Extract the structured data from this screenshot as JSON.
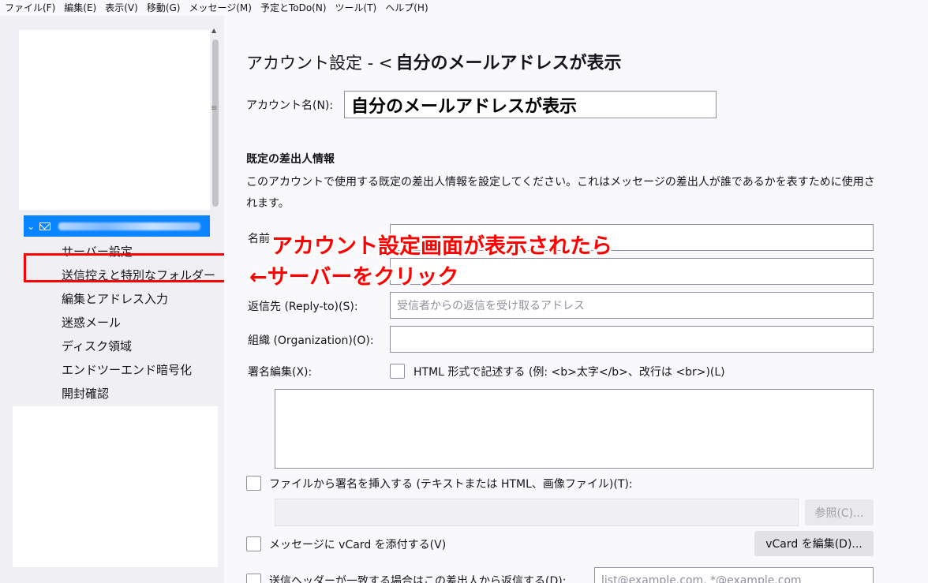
{
  "menubar": {
    "items": [
      "ファイル(F)",
      "編集(E)",
      "表示(V)",
      "移動(G)",
      "メッセージ(M)",
      "予定とToDo(N)",
      "ツール(T)",
      "ヘルプ(H)"
    ]
  },
  "sidebar": {
    "nav_items": [
      "サーバー設定",
      "送信控えと特別なフォルダー",
      "編集とアドレス入力",
      "迷惑メール",
      "ディスク領域",
      "エンドツーエンド暗号化",
      "開封確認"
    ]
  },
  "main": {
    "title_prefix": "アカウント設定 - <",
    "title_account": "自分のメールアドレスが表示",
    "account_name_label": "アカウント名(N):",
    "account_name_value": "自分のメールアドレスが表示",
    "section_heading": "既定の差出人情報",
    "description": "このアカウントで使用する既定の差出人情報を設定してください。これはメッセージの差出人が誰であるかを表すために使用されます。",
    "name_label": "名前",
    "reply_to_label": "返信先 (Reply-to)(S):",
    "reply_to_placeholder": "受信者からの返信を受け取るアドレス",
    "organization_label": "組織 (Organization)(O):",
    "signature_label": "署名編集(X):",
    "html_checkbox_label": "HTML 形式で記述する (例: <b>太字</b>、改行は <br>)(L)",
    "file_signature_label": "ファイルから署名を挿入する (テキストまたは HTML、画像ファイル)(T):",
    "browse_button": "参照(C)...",
    "vcard_label": "メッセージに vCard を添付する(V)",
    "vcard_edit_button": "vCard を編集(D)...",
    "reply_header_label": "送信ヘッダーが一致する場合はこの差出人から返信する(D):",
    "reply_header_placeholder": "list@example.com, *@example.com"
  },
  "annotations": {
    "line1": "アカウント設定画面が表示されたら",
    "line2": "←サーバーをクリック"
  },
  "colors": {
    "annotation": "#ff0000",
    "selection": "#0a84ff"
  }
}
